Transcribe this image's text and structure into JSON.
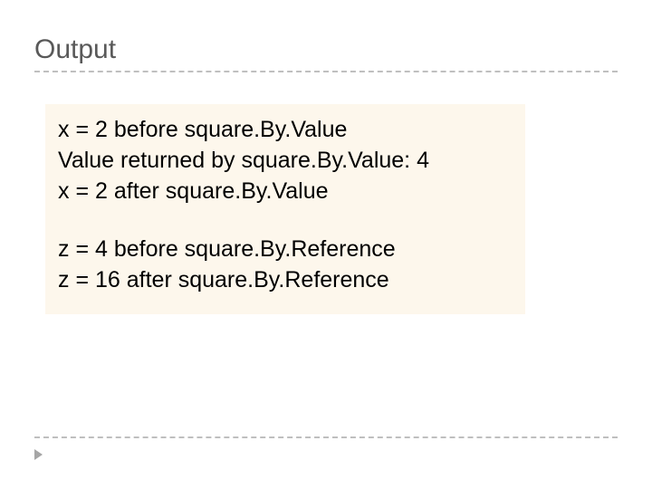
{
  "title": "Output",
  "lines": {
    "l1": "x = 2 before square.By.Value",
    "l2": "Value returned by square.By.Value: 4",
    "l3": "x = 2 after square.By.Value",
    "l4": "z = 4 before square.By.Reference",
    "l5": "z = 16 after square.By.Reference"
  }
}
